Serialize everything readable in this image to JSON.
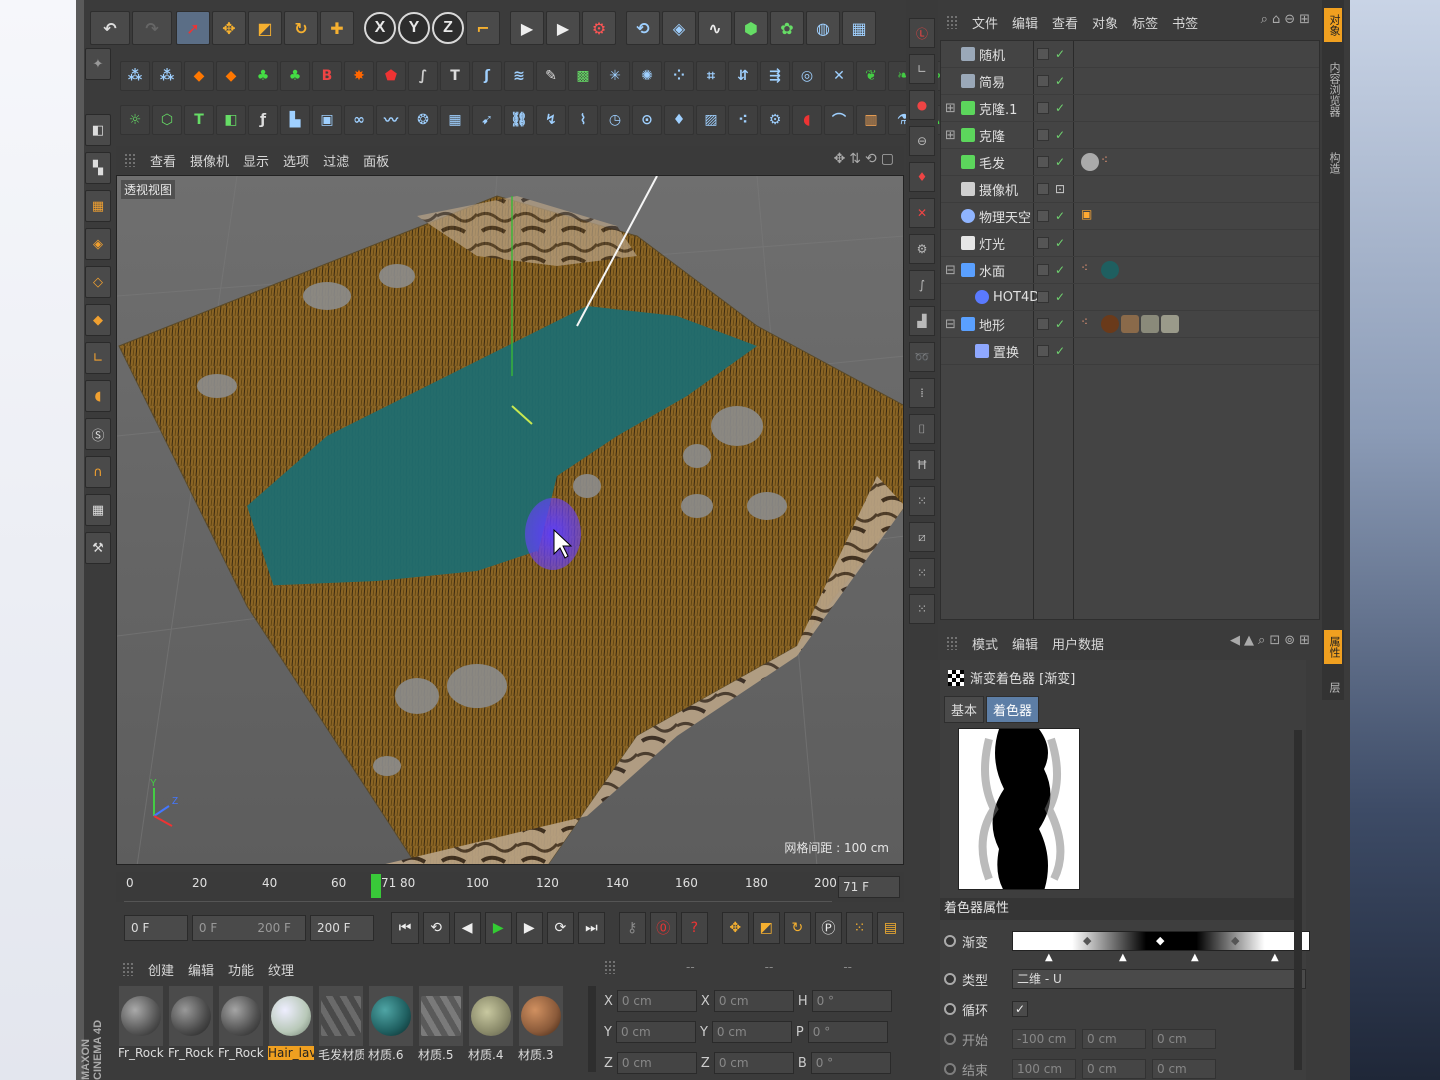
{
  "viewport": {
    "menu": [
      "查看",
      "摄像机",
      "显示",
      "选项",
      "过滤",
      "面板"
    ],
    "label": "透视视图",
    "grid_spacing": "网格间距 : 100 cm"
  },
  "objects": {
    "menu": [
      "文件",
      "编辑",
      "查看",
      "对象",
      "标签",
      "书签"
    ],
    "items": [
      {
        "name": "随机",
        "color": "#9aa8b8"
      },
      {
        "name": "简易",
        "color": "#9aa8b8"
      },
      {
        "name": "克隆.1",
        "color": "#5cd65c"
      },
      {
        "name": "克隆",
        "color": "#5cd65c"
      },
      {
        "name": "毛发",
        "color": "#5cd65c"
      },
      {
        "name": "摄像机",
        "color": "#d0d0d0"
      },
      {
        "name": "物理天空",
        "color": "#8fb4ff"
      },
      {
        "name": "灯光",
        "color": "#e6e6e6"
      },
      {
        "name": "水面",
        "color": "#5aa0ff"
      },
      {
        "name": "HOT4D",
        "color": "#5a7aff"
      },
      {
        "name": "地形",
        "color": "#5aa0ff"
      },
      {
        "name": "置换",
        "color": "#8fa8ff"
      }
    ]
  },
  "side_tabs": [
    "对象",
    "内容浏览器",
    "构造",
    "属性",
    "层"
  ],
  "attributes": {
    "menu": [
      "模式",
      "编辑",
      "用户数据"
    ],
    "title": "渐变着色器 [渐变]",
    "tabs": [
      "基本",
      "着色器"
    ],
    "section": "着色器属性",
    "gradient_label": "渐变",
    "type_label": "类型",
    "type_value": "二维 - U",
    "cycle_label": "循环",
    "cycle_value": "✓",
    "start_label": "开始",
    "start_values": [
      "-100 cm",
      "0 cm",
      "0 cm"
    ],
    "end_label": "结束",
    "end_values": [
      "100 cm",
      "0 cm",
      "0 cm"
    ]
  },
  "timeline": {
    "ticks": [
      "0",
      "20",
      "40",
      "60",
      "80",
      "100",
      "120",
      "140",
      "160",
      "180",
      "200"
    ],
    "current_frame_marker": "71",
    "current_frame": "71 F"
  },
  "transport": {
    "start_field": "0 F",
    "range_start": "0 F",
    "range_end": "200 F",
    "end_field": "200 F"
  },
  "materials": {
    "menu": [
      "创建",
      "编辑",
      "功能",
      "纹理"
    ],
    "items": [
      {
        "label": "Fr_Rock",
        "color": "#7a7a7a"
      },
      {
        "label": "Fr_Rock",
        "color": "#6a6a6a"
      },
      {
        "label": "Fr_Rock",
        "color": "#777777"
      },
      {
        "label": "Hair_lav",
        "color": "#c8d8c8"
      },
      {
        "label": "毛发材质",
        "color": "#5e5e5e"
      },
      {
        "label": "材质.6",
        "color": "#1f5f60"
      },
      {
        "label": "材质.5",
        "color": "#6e6e6e"
      },
      {
        "label": "材质.4",
        "color": "#9a9a7a"
      },
      {
        "label": "材质.3",
        "color": "#8a5a3a"
      }
    ]
  },
  "coordinates": {
    "header": [
      "--",
      "--",
      "--"
    ],
    "rows": [
      {
        "a": "X",
        "av": "0 cm",
        "b": "X",
        "bv": "0 cm",
        "c": "H",
        "cv": "0 °"
      },
      {
        "a": "Y",
        "av": "0 cm",
        "b": "Y",
        "bv": "0 cm",
        "c": "P",
        "cv": "0 °"
      },
      {
        "a": "Z",
        "av": "0 cm",
        "b": "Z",
        "bv": "0 cm",
        "c": "B",
        "cv": "0 °"
      }
    ]
  },
  "brand": "MAXON CINEMA 4D",
  "toolbar": {
    "axis_x": "X",
    "axis_y": "Y",
    "axis_z": "Z"
  }
}
